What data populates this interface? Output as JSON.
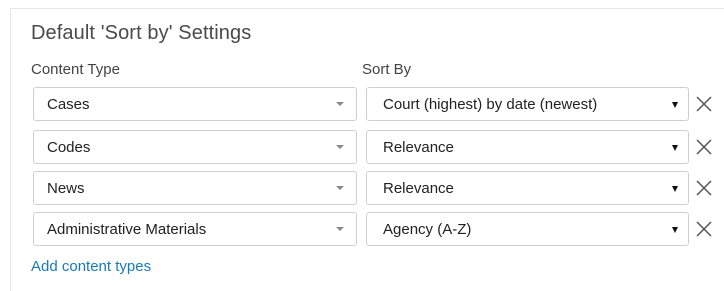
{
  "settings": {
    "title": "Default 'Sort by' Settings",
    "content_type_header": "Content Type",
    "sort_by_header": "Sort By",
    "rows": [
      {
        "content_type": "Cases",
        "sort_by": "Court (highest) by date (newest)"
      },
      {
        "content_type": "Codes",
        "sort_by": "Relevance"
      },
      {
        "content_type": "News",
        "sort_by": "Relevance"
      },
      {
        "content_type": "Administrative Materials",
        "sort_by": "Agency (A-Z)"
      }
    ],
    "add_link": "Add content types"
  },
  "colors": {
    "link": "#1a7ab8",
    "border": "#cfcfcf",
    "text": "#222222"
  }
}
